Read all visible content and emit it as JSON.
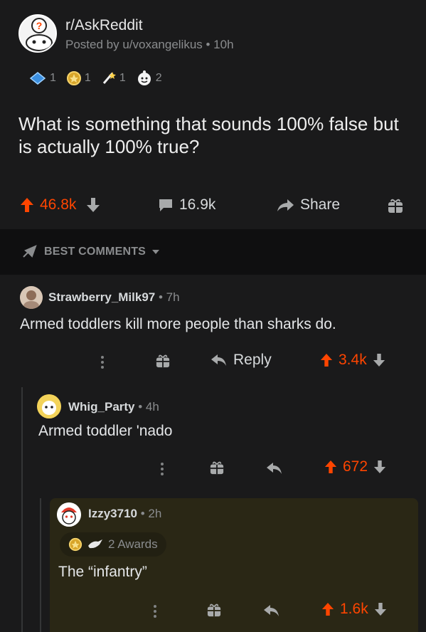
{
  "post": {
    "subreddit": "r/AskReddit",
    "posted_by": "Posted by u/voxangelikus • 10h",
    "awards": [
      {
        "icon": "blue-gem-award-icon",
        "count": "1"
      },
      {
        "icon": "gold-award-icon",
        "count": "1"
      },
      {
        "icon": "starry-award-icon",
        "count": "1"
      },
      {
        "icon": "wholesome-award-icon",
        "count": "2"
      }
    ],
    "title": "What is something that sounds 100% false but is actually 100% true?",
    "upvotes": "46.8k",
    "comments": "16.9k",
    "share_label": "Share"
  },
  "sort_label": "BEST COMMENTS",
  "comments": [
    {
      "author": "Strawberry_Milk97",
      "time": " • 7h",
      "body": "Armed toddlers kill more people than sharks do.",
      "reply_label": "Reply",
      "score": "3.4k"
    },
    {
      "author": "Whig_Party",
      "time": " • 4h",
      "body": "Armed toddler 'nado",
      "score": "672"
    },
    {
      "author": "Izzy3710",
      "time": " • 2h",
      "awards_label": "2 Awards",
      "body": "The “infantry”",
      "score": "1.6k"
    }
  ],
  "colors": {
    "background": "#1a1a1b",
    "upvote": "#ff4500",
    "highlight": "#2a2715"
  }
}
